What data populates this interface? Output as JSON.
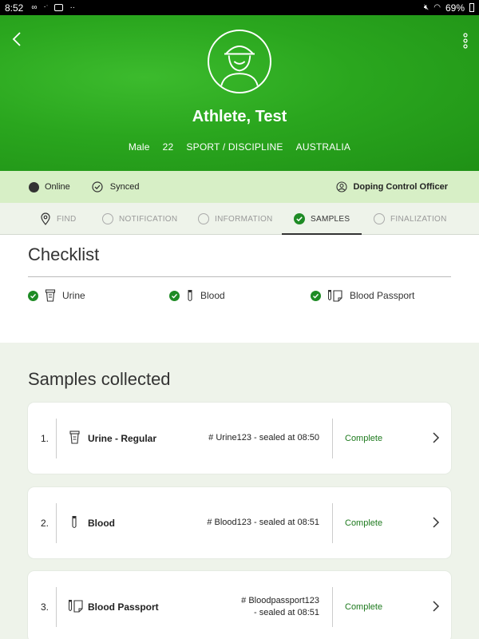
{
  "statusbar": {
    "time": "8:52",
    "battery": "69%"
  },
  "header": {
    "name": "Athlete, Test",
    "gender": "Male",
    "age": "22",
    "sport": "SPORT / DISCIPLINE",
    "country": "AUSTRALIA"
  },
  "strip": {
    "online": "Online",
    "synced": "Synced",
    "role": "Doping Control Officer"
  },
  "tabs": [
    {
      "label": "FIND"
    },
    {
      "label": "NOTIFICATION"
    },
    {
      "label": "INFORMATION"
    },
    {
      "label": "SAMPLES"
    },
    {
      "label": "FINALIZATION"
    }
  ],
  "checklist": {
    "title": "Checklist",
    "items": [
      {
        "label": "Urine"
      },
      {
        "label": "Blood"
      },
      {
        "label": "Blood Passport"
      }
    ]
  },
  "samples": {
    "title": "Samples collected",
    "items": [
      {
        "num": "1.",
        "name": "Urine - Regular",
        "seal_line1": "# Urine123 - sealed at 08:50",
        "seal_line2": "",
        "status": "Complete"
      },
      {
        "num": "2.",
        "name": "Blood",
        "seal_line1": "# Blood123 - sealed at 08:51",
        "seal_line2": "",
        "status": "Complete"
      },
      {
        "num": "3.",
        "name": "Blood Passport",
        "seal_line1": "# Bloodpassport123",
        "seal_line2": "- sealed at 08:51",
        "status": "Complete"
      }
    ]
  },
  "colors": {
    "header_green": "#2aa61e",
    "strip_green": "#d7efc6",
    "check_green": "#1e8b25",
    "status_green": "#1e7a1e"
  }
}
